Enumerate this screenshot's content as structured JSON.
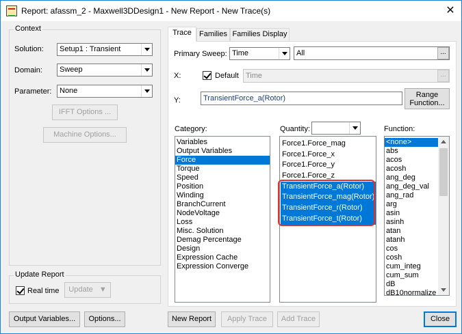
{
  "window": {
    "title": "Report: afassm_2 - Maxwell3DDesign1 - New Report - New Trace(s)"
  },
  "context": {
    "group_label": "Context",
    "solution_label": "Solution:",
    "solution_value": "Setup1 : Transient",
    "domain_label": "Domain:",
    "domain_value": "Sweep",
    "parameter_label": "Parameter:",
    "parameter_value": "None",
    "ifft_button": "IFFT Options ...",
    "machine_button": "Machine Options..."
  },
  "update_report": {
    "group_label": "Update Report",
    "realtime_label": "Real time",
    "realtime_checked": true,
    "update_button": "Update"
  },
  "tabs": [
    "Trace",
    "Families",
    "Families Display"
  ],
  "trace": {
    "primary_sweep_label": "Primary Sweep:",
    "primary_sweep_value": "Time",
    "primary_sweep_range": "All",
    "x_label": "X:",
    "default_label": "Default",
    "default_checked": true,
    "x_value": "Time",
    "y_label": "Y:",
    "y_value": "TransientForce_a(Rotor)",
    "range_function_button": "Range\nFunction...",
    "category_label": "Category:",
    "quantity_label": "Quantity:",
    "quantity_filter": "",
    "function_label": "Function:",
    "categories": [
      "Variables",
      "Output Variables",
      "Force",
      "Torque",
      "Speed",
      "Position",
      "Winding",
      "BranchCurrent",
      "NodeVoltage",
      "Loss",
      "Misc. Solution",
      "Demag Percentage",
      "Design",
      "Expression Cache",
      "Expression Converge"
    ],
    "selected_category": "Force",
    "quantities": [
      "Force1.Force_mag",
      "Force1.Force_x",
      "Force1.Force_y",
      "Force1.Force_z",
      "TransientForce_a(Rotor)",
      "TransientForce_mag(Rotor)",
      "TransientForce_r(Rotor)",
      "TransientForce_t(Rotor)"
    ],
    "selected_quantities": [
      "TransientForce_a(Rotor)",
      "TransientForce_mag(Rotor)",
      "TransientForce_r(Rotor)",
      "TransientForce_t(Rotor)"
    ],
    "functions": [
      "<none>",
      "abs",
      "acos",
      "acosh",
      "ang_deg",
      "ang_deg_val",
      "ang_rad",
      "arg",
      "asin",
      "asinh",
      "atan",
      "atanh",
      "cos",
      "cosh",
      "cum_integ",
      "cum_sum",
      "dB",
      "dB10normalize"
    ],
    "selected_function": "<none>"
  },
  "footer": {
    "output_variables_button": "Output Variables...",
    "options_button": "Options...",
    "new_report_button": "New Report",
    "apply_trace_button": "Apply Trace",
    "add_trace_button": "Add Trace",
    "close_button": "Close"
  },
  "colors": {
    "selection": "#0078d7",
    "highlight_box": "#e0312a",
    "window_border": "#1883d7"
  }
}
